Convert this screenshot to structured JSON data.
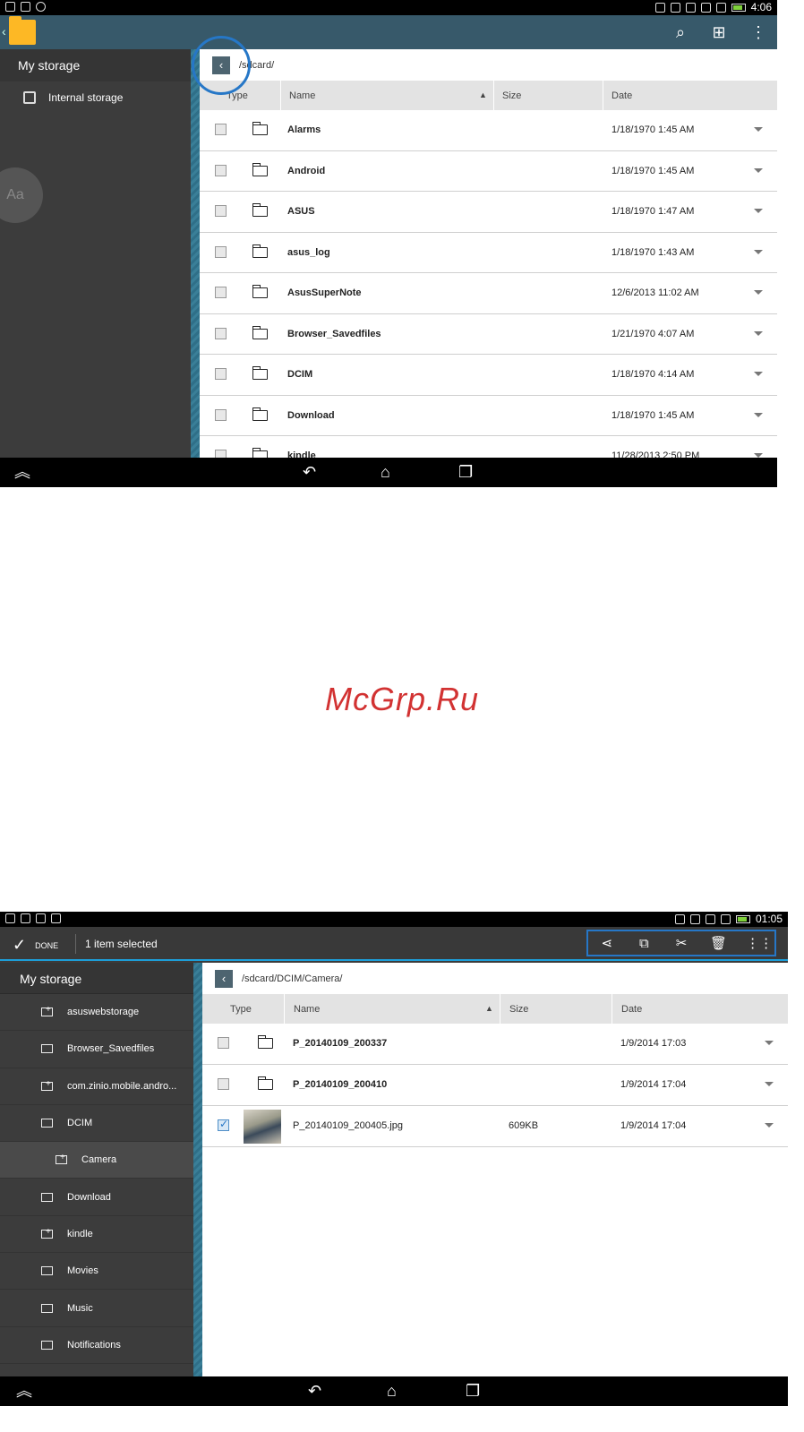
{
  "screen1": {
    "path": "/sdcard/",
    "sidebar": {
      "header": "My storage",
      "items": [
        {
          "label": "Internal storage"
        }
      ]
    },
    "columns": {
      "type": "Type",
      "name": "Name",
      "size": "Size",
      "date": "Date"
    },
    "rows": [
      {
        "name": "Alarms",
        "date": "1/18/1970 1:45 AM"
      },
      {
        "name": "Android",
        "date": "1/18/1970 1:45 AM"
      },
      {
        "name": "ASUS",
        "date": "1/18/1970 1:47 AM"
      },
      {
        "name": "asus_log",
        "date": "1/18/1970 1:43 AM"
      },
      {
        "name": "AsusSuperNote",
        "date": "12/6/2013 11:02 AM"
      },
      {
        "name": "Browser_Savedfiles",
        "date": "1/21/1970 4:07 AM"
      },
      {
        "name": "DCIM",
        "date": "1/18/1970 4:14 AM"
      },
      {
        "name": "Download",
        "date": "1/18/1970 1:45 AM"
      },
      {
        "name": "kindle",
        "date": "11/28/2013 2:50 PM"
      }
    ],
    "status_time": "4:06"
  },
  "watermark": "McGrp.Ru",
  "screen2": {
    "status_time": "01:05",
    "done_label": "DONE",
    "selection_text": "1 item selected",
    "path": "/sdcard/DCIM/Camera/",
    "sidebar": {
      "header": "My storage",
      "items": [
        {
          "label": "asuswebstorage"
        },
        {
          "label": "Browser_Savedfiles"
        },
        {
          "label": "com.zinio.mobile.andro..."
        },
        {
          "label": "DCIM"
        },
        {
          "label": "Camera"
        },
        {
          "label": "Download"
        },
        {
          "label": "kindle"
        },
        {
          "label": "Movies"
        },
        {
          "label": "Music"
        },
        {
          "label": "Notifications"
        }
      ]
    },
    "columns": {
      "type": "Type",
      "name": "Name",
      "size": "Size",
      "date": "Date"
    },
    "rows": [
      {
        "name": "P_20140109_200337",
        "size": "",
        "date": "1/9/2014 17:03"
      },
      {
        "name": "P_20140109_200410",
        "size": "",
        "date": "1/9/2014 17:04"
      },
      {
        "name": "P_20140109_200405.jpg",
        "size": "609KB",
        "date": "1/9/2014 17:04"
      }
    ]
  }
}
